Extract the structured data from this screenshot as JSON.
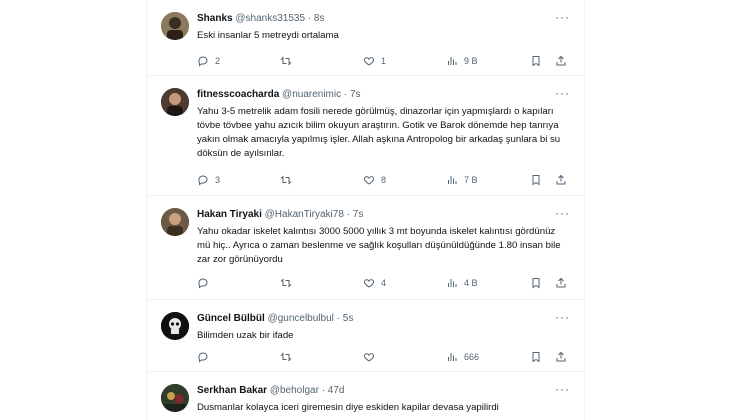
{
  "tweets": [
    {
      "name": "Shanks",
      "handle": "@shanks31535",
      "time": "· 8s",
      "text": "Eski insanlar 5 metreydi ortalama",
      "replies": "2",
      "retweets": "",
      "likes": "1",
      "views": "9 B",
      "avatar_color": "#8a7a5e"
    },
    {
      "name": "fitnesscoacharda",
      "handle": "@nuarenimic",
      "time": "· 7s",
      "text": "Yahu 3-5 metrelik adam fosili nerede görülmüş, dinazorlar için yapmışlardı o kapıları tövbe tövbee yahu azıcık bilim okuyun araştırın. Gotik ve Barok dönemde hep tanrıya yakın olmak amacıyla yapılmış işler. Allah aşkına Antropolog bir arkadaş şunlara bi su döksün de ayılsınlar.",
      "replies": "3",
      "retweets": "",
      "likes": "8",
      "views": "7 B",
      "avatar_color": "#4d3b32"
    },
    {
      "name": "Hakan Tiryaki",
      "handle": "@HakanTiryaki78",
      "time": "· 7s",
      "text": "Yahu okadar iskelet kalıntısı 3000 5000 yıllık 3 mt boyunda iskelet kalıntısı gördünüz mü hiç.. Ayrıca o zaman beslenme ve sağlık koşulları düşünüldüğünde 1.80 insan bile zar zor görünüyordu",
      "replies": "",
      "retweets": "",
      "likes": "4",
      "views": "4 B",
      "avatar_color": "#6b5a45"
    },
    {
      "name": "Güncel Bülbül",
      "handle": "@guncelbulbul",
      "time": "· 5s",
      "text": "Bilimden uzak bir ifade",
      "replies": "",
      "retweets": "",
      "likes": "",
      "views": "666",
      "avatar_color": "#111111"
    },
    {
      "name": "Serkhan Bakar",
      "handle": "@beholgar",
      "time": "· 47d",
      "text": "Dusmanlar kolayca iceri giremesin diye eskiden kapilar devasa yapilirdi",
      "replies": "",
      "retweets": "",
      "likes": "",
      "views": "",
      "avatar_color": "#2f3d2a"
    }
  ],
  "icons": {
    "more": "more-dots-icon",
    "reply": "reply-icon",
    "retweet": "retweet-icon",
    "like": "heart-icon",
    "views": "views-icon",
    "bookmark": "bookmark-icon",
    "share": "share-icon"
  },
  "colors": {
    "text": "#0f1419",
    "secondary": "#536471",
    "divider": "#eff3f4"
  }
}
